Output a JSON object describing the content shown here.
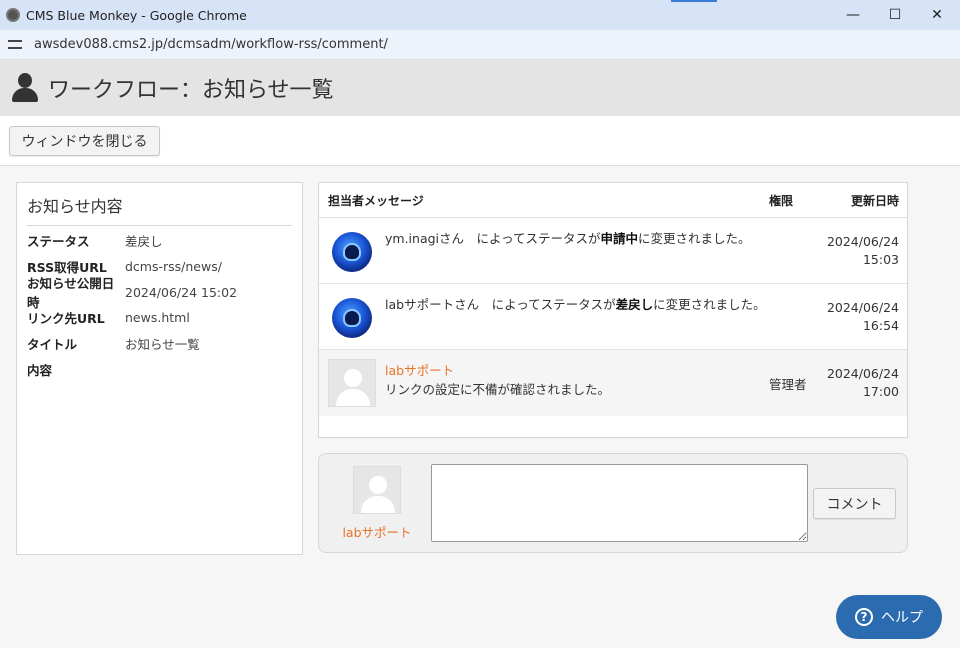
{
  "window": {
    "title": "CMS Blue Monkey - Google Chrome",
    "minimize": "—",
    "maximize": "☐",
    "close": "✕"
  },
  "address": {
    "url": "awsdev088.cms2.jp/dcmsadm/workflow-rss/comment/"
  },
  "header": {
    "title": "ワークフロー：お知らせ一覧"
  },
  "toolbar": {
    "close_label": "ウィンドウを閉じる"
  },
  "info": {
    "title": "お知らせ内容",
    "rows": [
      {
        "label": "ステータス",
        "value": "差戻し"
      },
      {
        "label": "RSS取得URL",
        "value": "dcms-rss/news/"
      },
      {
        "label": "お知らせ公開日時",
        "value": "2024/06/24 15:02"
      },
      {
        "label": "リンク先URL",
        "value": "news.html"
      },
      {
        "label": "タイトル",
        "value": "お知らせ一覧"
      },
      {
        "label": "内容",
        "value": ""
      }
    ]
  },
  "messages": {
    "headers": {
      "message": "担当者メッセージ",
      "role": "権限",
      "updated": "更新日時"
    },
    "rows": [
      {
        "pre": "ym.inagiさん　によってステータスが",
        "status": "申請中",
        "post": "に変更されました。",
        "date": "2024/06/24",
        "time": "15:03"
      },
      {
        "pre": "labサポートさん　によってステータスが",
        "status": "差戻し",
        "post": "に変更されました。",
        "date": "2024/06/24",
        "time": "16:54"
      },
      {
        "name": "labサポート",
        "comment": "リンクの設定に不備が確認されました。",
        "role": "管理者",
        "date": "2024/06/24",
        "time": "17:00"
      }
    ]
  },
  "comment": {
    "user": "labサポート",
    "value": "",
    "button": "コメント"
  },
  "help": {
    "label": "ヘルプ",
    "icon": "?"
  },
  "colors": {
    "accent": "#e8742a",
    "help": "#2b6cb0",
    "titlebar": "#d7e3f7"
  }
}
